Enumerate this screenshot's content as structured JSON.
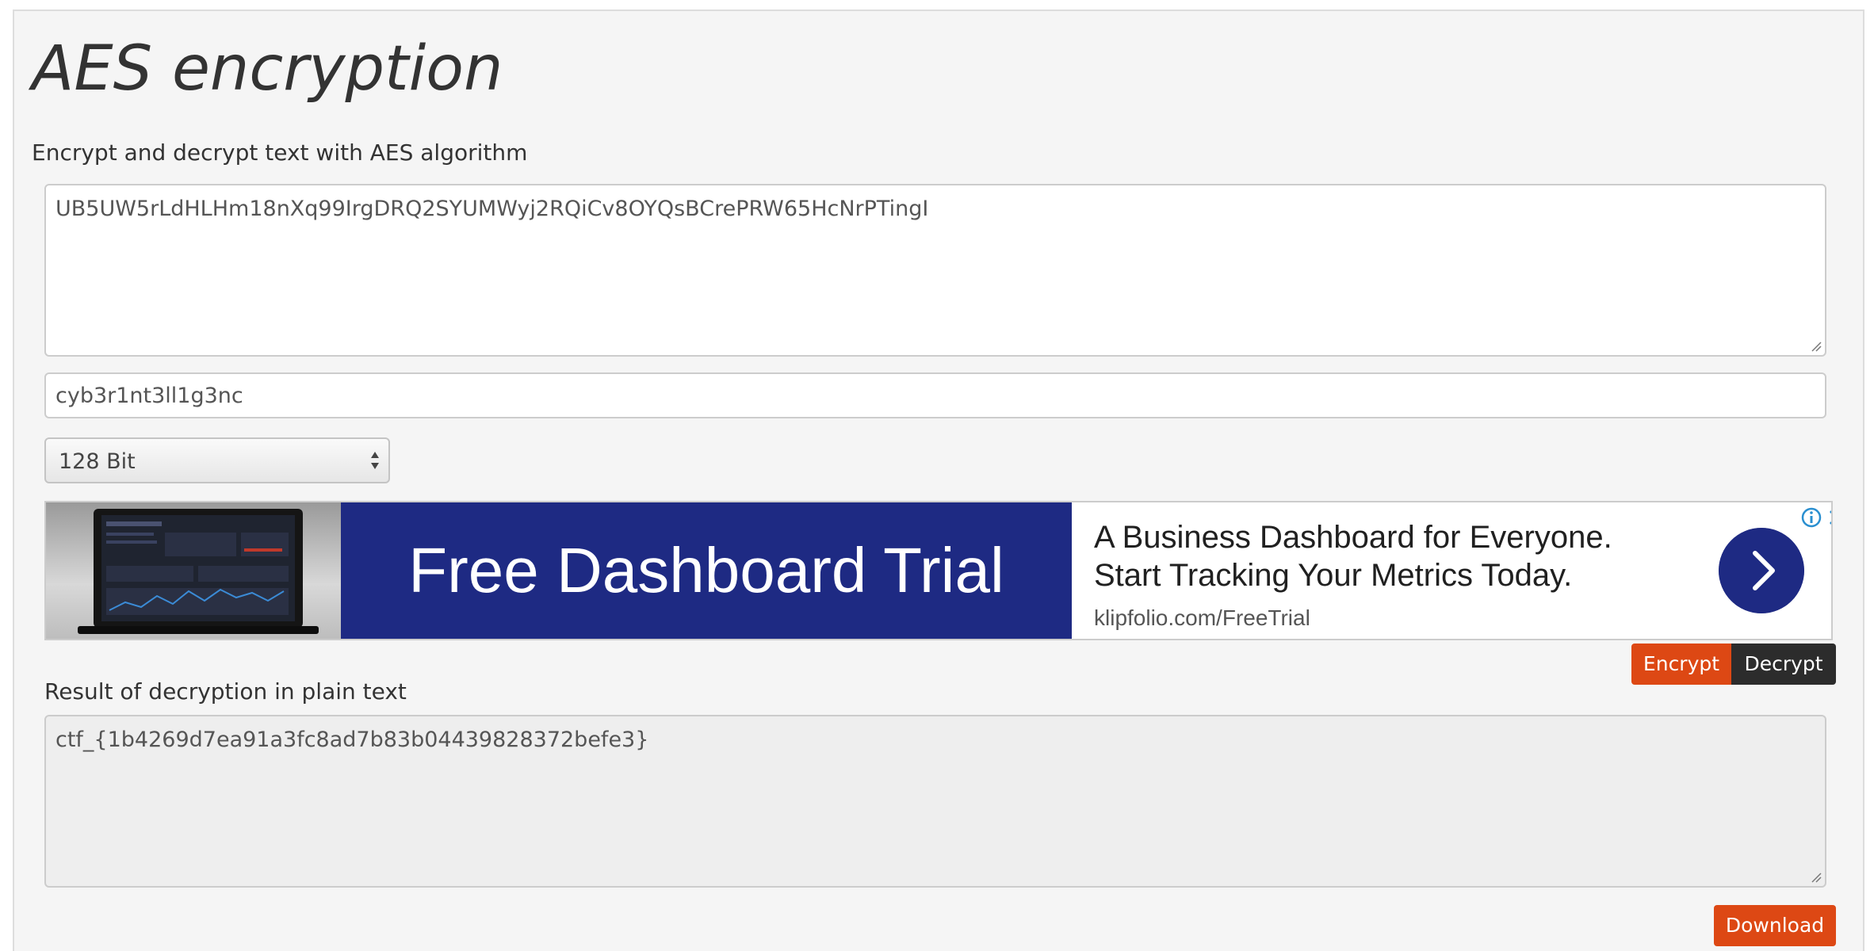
{
  "header": {
    "title": "AES encryption",
    "subtitle": "Encrypt and decrypt text with AES algorithm"
  },
  "input": {
    "ciphertext": "UB5UW5rLdHLHm18nXq99IrgDRQ2SYUMWyj2RQiCv8OYQsBCrePRW65HcNrPTingI",
    "key": "cyb3r1nt3ll1g3nc",
    "key_size": "128 Bit"
  },
  "ad": {
    "banner_text": "Free Dashboard Trial",
    "headline_line1": "A Business Dashboard for Everyone.",
    "headline_line2": "Start Tracking Your Metrics Today.",
    "url": "klipfolio.com/FreeTrial",
    "brand_color": "#1e2a83"
  },
  "actions": {
    "encrypt_label": "Encrypt",
    "decrypt_label": "Decrypt",
    "download_label": "Download"
  },
  "result": {
    "label": "Result of decryption in plain text",
    "value": "ctf_{1b4269d7ea91a3fc8ad7b83b04439828372befe3}"
  },
  "colors": {
    "accent": "#dd4814",
    "dark_button": "#2c2c2c",
    "panel_background": "#f5f5f5"
  }
}
